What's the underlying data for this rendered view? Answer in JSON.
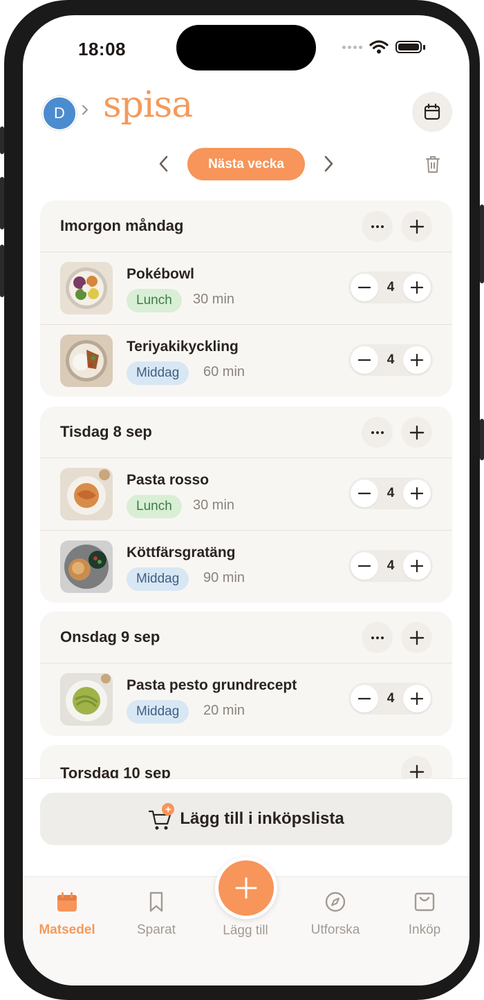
{
  "status_bar": {
    "time": "18:08"
  },
  "header": {
    "avatar_initial": "D",
    "logo": "spisa"
  },
  "week_nav": {
    "label": "Nästa vecka"
  },
  "days": [
    {
      "title": "Imorgon måndag",
      "meals": [
        {
          "name": "Pokébowl",
          "tag": "Lunch",
          "duration": "30 min",
          "servings": "4"
        },
        {
          "name": "Teriyakikyckling",
          "tag": "Middag",
          "duration": "60 min",
          "servings": "4"
        }
      ]
    },
    {
      "title": "Tisdag 8 sep",
      "meals": [
        {
          "name": "Pasta rosso",
          "tag": "Lunch",
          "duration": "30 min",
          "servings": "4"
        },
        {
          "name": "Köttfärsgratäng",
          "tag": "Middag",
          "duration": "90 min",
          "servings": "4"
        }
      ]
    },
    {
      "title": "Onsdag 9 sep",
      "meals": [
        {
          "name": "Pasta pesto grundrecept",
          "tag": "Middag",
          "duration": "20 min",
          "servings": "4"
        }
      ]
    },
    {
      "title": "Torsdag 10 sep",
      "meals": []
    }
  ],
  "shopping_button": {
    "label": "Lägg till i inköpslista",
    "badge": "+"
  },
  "tabs": {
    "matsedel": "Matsedel",
    "sparat": "Sparat",
    "lagg_till": "Lägg till",
    "utforska": "Utforska",
    "inkop": "Inköp"
  },
  "colors": {
    "accent": "#f7955a",
    "lunch_tag": "#d8efd6",
    "middag_tag": "#d8e7f4",
    "avatar": "#4b8bd0"
  }
}
